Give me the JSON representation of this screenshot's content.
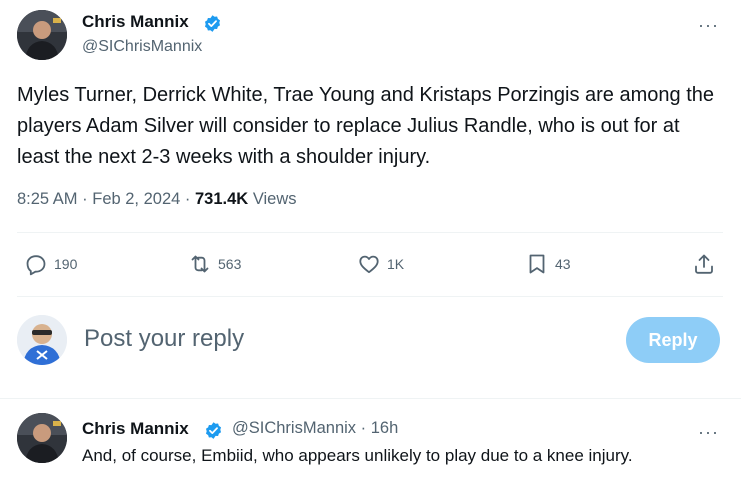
{
  "tweet": {
    "author_name": "Chris Mannix",
    "handle": "@SIChrisMannix",
    "text": "Myles Turner, Derrick White, Trae Young and Kristaps Porzingis are among the players Adam Silver will consider to replace Julius Randle, who is out for at least the next 2-3 weeks with a shoulder injury.",
    "time": "8:25 AM",
    "date": "Feb 2, 2024",
    "views_count": "731.4K",
    "views_label": "Views",
    "more_label": "···"
  },
  "actions": {
    "replies": "190",
    "reposts": "563",
    "likes": "1K",
    "bookmarks": "43"
  },
  "reply_box": {
    "placeholder": "Post your reply",
    "button_label": "Reply"
  },
  "reply_tweet": {
    "author_name": "Chris Mannix",
    "handle": "@SIChrisMannix",
    "separator": "·",
    "age": "16h",
    "text": "And, of course, Embiid, who appears unlikely to play due to a knee injury.",
    "more_label": "···"
  },
  "colors": {
    "accent": "#1d9bf0",
    "reply_button_disabled": "#8ecdf7",
    "secondary_text": "#536471",
    "primary_text": "#0f1419",
    "divider": "#eff3f4"
  },
  "icons": {
    "verified": "verified-badge-icon",
    "reply": "speech-bubble-icon",
    "repost": "repost-arrows-icon",
    "like": "heart-icon",
    "bookmark": "bookmark-icon",
    "share": "share-upload-icon",
    "more": "more-dots-icon"
  }
}
